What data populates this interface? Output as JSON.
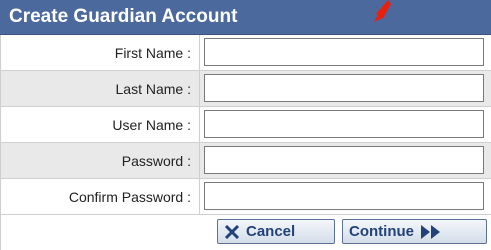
{
  "header": {
    "title": "Create Guardian Account"
  },
  "fields": [
    {
      "label": "First Name :",
      "value": ""
    },
    {
      "label": "Last Name :",
      "value": ""
    },
    {
      "label": "User Name :",
      "value": ""
    },
    {
      "label": "Password :",
      "value": ""
    },
    {
      "label": "Confirm Password :",
      "value": ""
    }
  ],
  "buttons": {
    "cancel": "Cancel",
    "continue": "Continue"
  },
  "colors": {
    "header_bg": "#4b699c",
    "alt_row_bg": "#e9e9e9",
    "button_text": "#24427a",
    "arrow": "#e8200c"
  }
}
